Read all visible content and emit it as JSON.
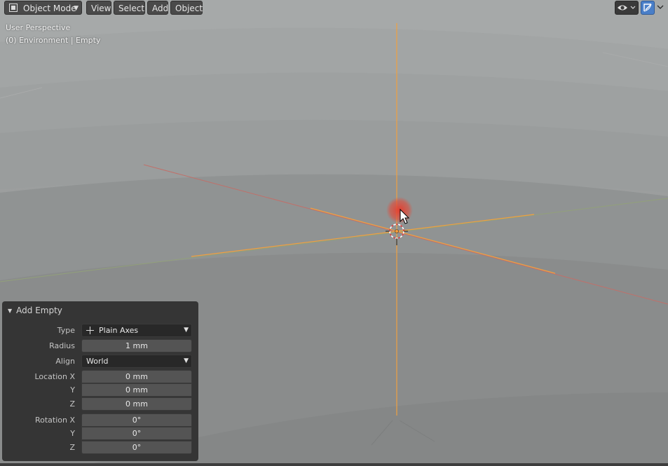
{
  "header": {
    "mode": "Object Mode",
    "menus": [
      "View",
      "Select",
      "Add",
      "Object"
    ],
    "right_icons": [
      "visibility-icon",
      "gizmo-icon"
    ]
  },
  "viewport": {
    "perspective": "User Perspective",
    "context": "(0) Environment | Empty"
  },
  "operator_panel": {
    "title": "Add Empty",
    "type_label": "Type",
    "type_value": "Plain Axes",
    "radius_label": "Radius",
    "radius_value": "1 mm",
    "align_label": "Align",
    "align_value": "World",
    "location_label": "Location X",
    "location_x": "0 mm",
    "location_y_label": "Y",
    "location_y": "0 mm",
    "location_z_label": "Z",
    "location_z": "0 mm",
    "rotation_label": "Rotation X",
    "rotation_x": "0°",
    "rotation_y_label": "Y",
    "rotation_y": "0°",
    "rotation_z_label": "Z",
    "rotation_z": "0°"
  },
  "colors": {
    "selected_empty": "#f29a3a",
    "x_axis": "#c85a5a",
    "y_axis": "#8aa05a",
    "cursor_highlight": "#e04a3a",
    "gizmo_active": "#4a7fc8"
  }
}
